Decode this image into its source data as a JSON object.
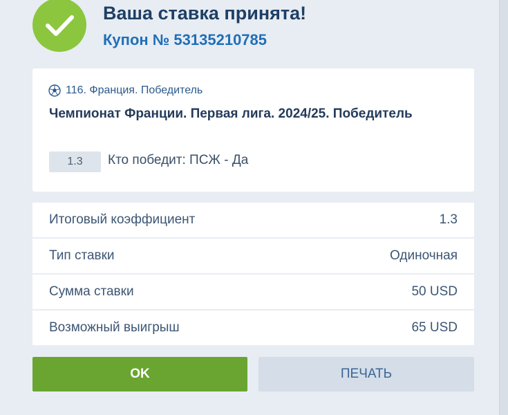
{
  "header": {
    "title": "Ваша ставка принята!",
    "coupon": "Купон № 53135210785"
  },
  "event": {
    "icon": "soccer-ball-icon",
    "header": "116. Франция. Победитель",
    "title": "Чемпионат Франции. Первая лига. 2024/25. Победитель",
    "odds": "1.3",
    "pick": "Кто победит: ПСЖ - Да"
  },
  "summary": [
    {
      "label": "Итоговый коэффициент",
      "value": "1.3"
    },
    {
      "label": "Тип ставки",
      "value": "Одиночная"
    },
    {
      "label": "Сумма ставки",
      "value": "50 USD"
    },
    {
      "label": "Возможный выигрыш",
      "value": "65 USD"
    }
  ],
  "buttons": {
    "ok_label": "OK",
    "print_label": "ПЕЧАТЬ"
  },
  "colors": {
    "success_green": "#8cc63f",
    "ok_button": "#6aa531",
    "title_blue": "#1e3f66",
    "coupon_blue": "#1f6fb8"
  }
}
